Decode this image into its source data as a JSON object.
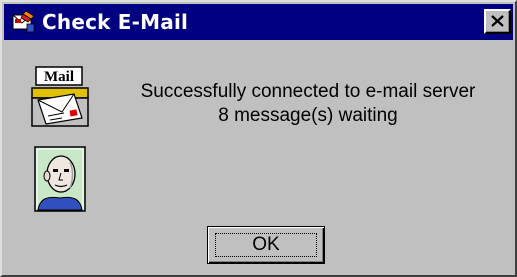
{
  "window": {
    "title": "Check E-Mail",
    "title_bar_color": "#000080",
    "face_color": "#c0c0c0"
  },
  "icons": {
    "app": "mail-app-icon",
    "close": "close-icon",
    "mail": "mail-envelope-icon",
    "user": "user-face-icon",
    "mail_icon_text": "Mail"
  },
  "message": {
    "line1": "Successfully connected to e-mail server",
    "line2": "8 message(s) waiting"
  },
  "buttons": {
    "ok_label": "OK"
  }
}
